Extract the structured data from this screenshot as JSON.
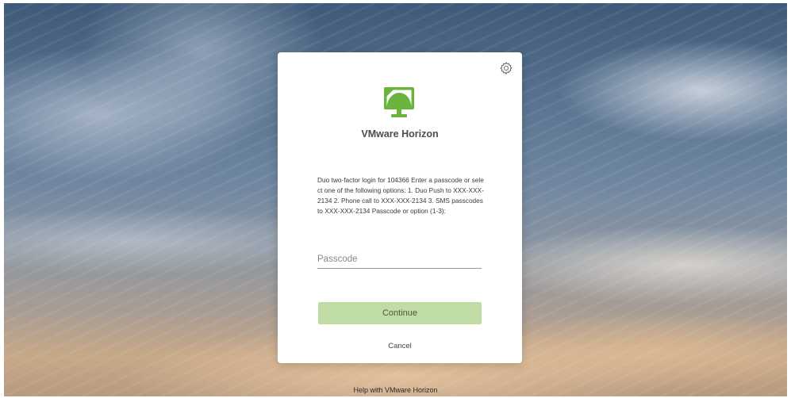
{
  "modal": {
    "product_name": "VMware Horizon",
    "message": "Duo two-factor login for 104366  Enter a passcode or select one of the following options:   1. Duo Push to XXX-XXX-2134  2. Phone call to XXX-XXX-2134  3. SMS passcodes to XXX-XXX-2134  Passcode or option (1-3):",
    "passcode": {
      "placeholder": "Passcode",
      "value": ""
    },
    "continue_label": "Continue",
    "cancel_label": "Cancel",
    "settings_icon": "gear-icon",
    "logo_icon": "vmware-horizon-logo"
  },
  "footer": {
    "help_link": "Help with VMware Horizon"
  },
  "colors": {
    "logo_green": "#6ab43e",
    "continue_button": "#bfdca4",
    "modal_background": "#ffffff"
  }
}
